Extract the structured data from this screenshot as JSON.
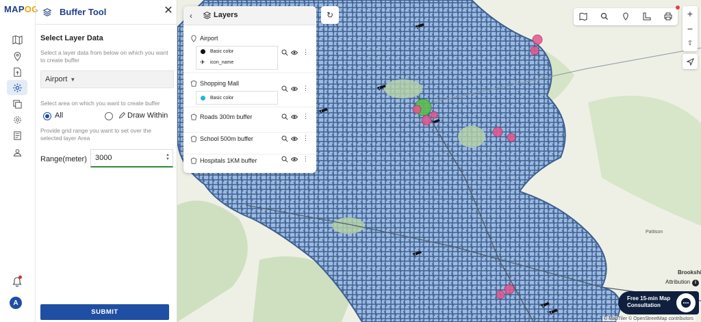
{
  "brand": {
    "logo_prefix": "MAP",
    "logo_suffix": "OG"
  },
  "rail": {
    "items": [
      {
        "icon": "map-icon"
      },
      {
        "icon": "location-pin-icon"
      },
      {
        "icon": "upload-file-icon"
      },
      {
        "icon": "gear-icon",
        "active": true
      },
      {
        "icon": "layers-image-icon"
      },
      {
        "icon": "settings-cog-icon"
      },
      {
        "icon": "report-icon"
      },
      {
        "icon": "user-map-icon"
      }
    ],
    "avatar_letter": "A"
  },
  "buffer_panel": {
    "title": "Buffer Tool",
    "select_layer_title": "Select Layer Data",
    "select_layer_hint": "Select a layer data from below on which you want to create buffer",
    "selected_layer": "Airport",
    "area_hint": "Select area on which you want to create buffer",
    "area_options": [
      {
        "label": "All",
        "selected": true
      },
      {
        "label": "Draw Within",
        "selected": false
      }
    ],
    "grid_hint": "Provide grid range you want to set over the selected layer Area",
    "range_label": "Range(meter)",
    "range_value": "3000",
    "submit_label": "SUBMIT"
  },
  "layers_panel": {
    "title": "Layers",
    "layers": [
      {
        "name": "Airport",
        "legend": [
          {
            "label": "Basic color",
            "color": "#111111"
          },
          {
            "label": "icon_name",
            "icon": "airplane-icon"
          }
        ]
      },
      {
        "name": "Shopping Mall",
        "legend": [
          {
            "label": "Basic color",
            "color": "#19b8d8"
          }
        ]
      },
      {
        "name": "Roads 300m buffer"
      },
      {
        "name": "School 500m buffer"
      },
      {
        "name": "Hospitals 1KM buffer"
      }
    ]
  },
  "map": {
    "labels": {
      "pattison": "Pattison",
      "brookshire": "Brookshi"
    },
    "attribution": "Attribution",
    "copyright": "© MapTiler © OpenStreetMap contributors",
    "consult_line1": "Free 15-min Map",
    "consult_line2": "Consultation",
    "colors": {
      "buffer_fill": "#8fb1dc",
      "buffer_stroke": "#3d5f8f",
      "hospital": "#e2578f",
      "school": "#4caf50"
    }
  }
}
